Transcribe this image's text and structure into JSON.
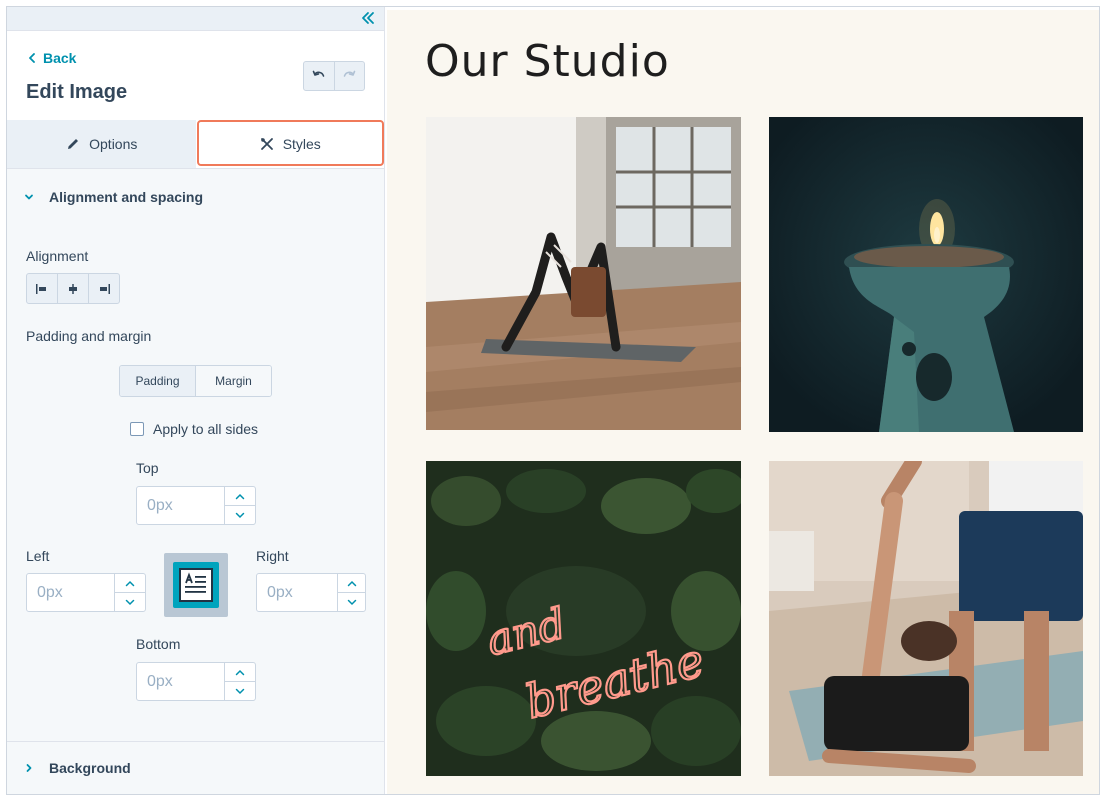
{
  "sidebar": {
    "collapse_icon": "double-chevron-left-icon",
    "back_label": "Back",
    "title": "Edit Image",
    "tabs": [
      {
        "label": "Options",
        "icon": "pencil-icon"
      },
      {
        "label": "Styles",
        "icon": "styles-icon",
        "active": true
      }
    ],
    "sections": {
      "alignment": {
        "title": "Alignment and spacing",
        "expanded": true,
        "alignment_label": "Alignment",
        "padding_margin_label": "Padding and margin",
        "segments": [
          "Padding",
          "Margin"
        ],
        "active_segment": "Padding",
        "apply_all_label": "Apply to all sides",
        "apply_all_checked": false,
        "fields": {
          "top": {
            "label": "Top",
            "placeholder": "0px"
          },
          "left": {
            "label": "Left",
            "placeholder": "0px"
          },
          "right": {
            "label": "Right",
            "placeholder": "0px"
          },
          "bottom": {
            "label": "Bottom",
            "placeholder": "0px"
          }
        }
      },
      "background": {
        "title": "Background",
        "expanded": false
      }
    }
  },
  "preview": {
    "page_title": "Our Studio",
    "photos": [
      {
        "subject": "yoga downward dog in studio"
      },
      {
        "subject": "lit candle on ceramic holder"
      },
      {
        "subject": "neon sign on greenery"
      },
      {
        "subject": "partner stretching"
      }
    ],
    "neon_text": [
      "and",
      "breathe"
    ]
  },
  "colors": {
    "accent": "#0091ae",
    "text": "#33475b",
    "highlight": "#f07a5a",
    "panel_bg": "#f5f8fa"
  }
}
